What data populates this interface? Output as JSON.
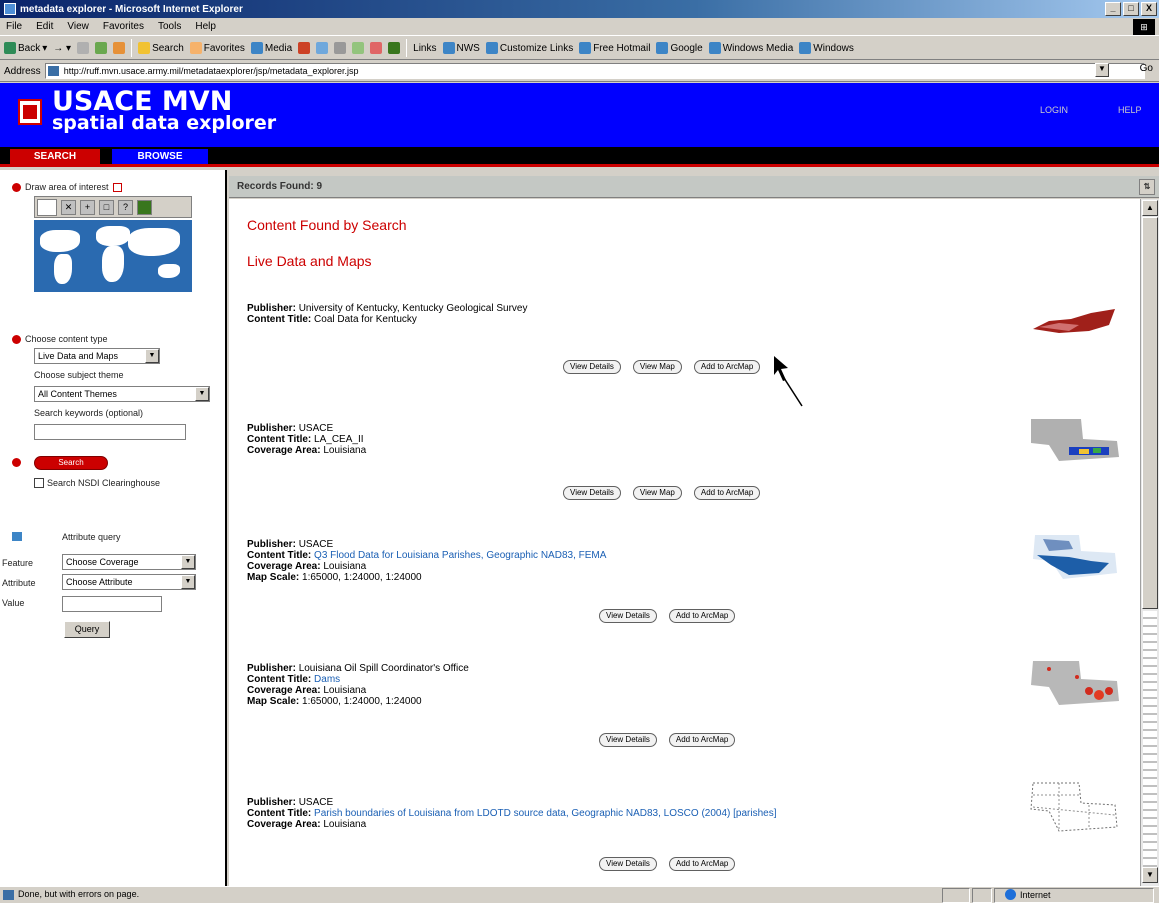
{
  "window": {
    "title": "metadata explorer - Microsoft Internet Explorer",
    "controls": [
      "_",
      "□",
      "X"
    ]
  },
  "menu": [
    "File",
    "Edit",
    "View",
    "Favorites",
    "Tools",
    "Help"
  ],
  "toolbar": {
    "back": "Back",
    "search": "Search",
    "favorites": "Favorites",
    "media": "Media",
    "links": [
      "Links",
      "NWS",
      "Customize Links",
      "Free Hotmail",
      "Google",
      "Windows Media",
      "Windows"
    ]
  },
  "address": {
    "label": "Address",
    "url": "http://ruff.mvn.usace.army.mil/metadataexplorer/jsp/metadata_explorer.jsp",
    "go": "Go"
  },
  "header": {
    "title": "USACE MVN",
    "subtitle": "spatial data explorer",
    "links": [
      "LOGIN",
      "HELP"
    ]
  },
  "tabs": [
    "SEARCH",
    "BROWSE"
  ],
  "left": {
    "step1": "Draw area of interest",
    "step2": "Choose content type",
    "content_type": "Live Data and Maps",
    "subject_label": "Choose subject theme",
    "subject_value": "All Content Themes",
    "keyword_label": "Search keywords (optional)",
    "search_button": "Search",
    "clearinghouse": "Search NSDI Clearinghouse",
    "attrib_title": "Attribute query",
    "attrib_rows": [
      {
        "label": "Feature",
        "value": "Choose Coverage"
      },
      {
        "label": "Attribute",
        "value": "Choose Attribute"
      },
      {
        "label": "Value",
        "value": ""
      }
    ],
    "query_button": "Query"
  },
  "results_header": "Records Found: 9",
  "sections": [
    "Content Found by Search",
    "Live Data and Maps"
  ],
  "results": [
    {
      "publisher": "University of Kentucky, Kentucky Geological Survey",
      "title": "Coal Data for Kentucky",
      "coverage": "",
      "scale": "",
      "title_is_link": false,
      "buttons": [
        "View Details",
        "View Map",
        "Add to ArcMap"
      ]
    },
    {
      "publisher": "USACE",
      "title": "LA_CEA_II",
      "coverage": "Louisiana",
      "scale": "",
      "title_is_link": false,
      "buttons": [
        "View Details",
        "View Map",
        "Add to ArcMap"
      ]
    },
    {
      "publisher": "USACE",
      "title": "Q3 Flood Data for Louisiana Parishes, Geographic NAD83, FEMA",
      "coverage": "Louisiana",
      "scale": "1:65000, 1:24000, 1:24000",
      "title_is_link": true,
      "buttons": [
        "View Details",
        "Add to ArcMap"
      ]
    },
    {
      "publisher": "Louisiana Oil Spill Coordinator's Office",
      "title": "Dams",
      "coverage": "Louisiana",
      "scale": "1:65000, 1:24000, 1:24000",
      "title_is_link": true,
      "buttons": [
        "View Details",
        "Add to ArcMap"
      ]
    },
    {
      "publisher": "USACE",
      "title": "Parish boundaries of Louisiana from LDOTD source data, Geographic NAD83, LOSCO (2004) [parishes]",
      "coverage": "Louisiana",
      "scale": "",
      "title_is_link": true,
      "buttons": [
        "View Details",
        "Add to ArcMap"
      ]
    }
  ],
  "labels": {
    "publisher": "Publisher:",
    "title": "Content Title:",
    "coverage": "Coverage Area:",
    "scale": "Map Scale:"
  },
  "status": {
    "text": "Done, but with errors on page.",
    "zone": "Internet"
  }
}
